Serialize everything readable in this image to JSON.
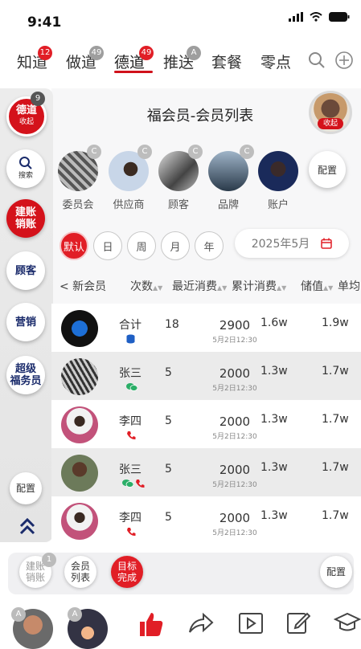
{
  "status": {
    "time": "9:41"
  },
  "topnav": {
    "tabs": [
      {
        "label": "知道",
        "badge": "12",
        "badge_color": "red"
      },
      {
        "label": "做道",
        "badge": "49",
        "badge_color": "gray"
      },
      {
        "label": "德道",
        "badge": "49",
        "badge_color": "red",
        "active": true
      },
      {
        "label": "推送",
        "badge": "A",
        "badge_color": "gray"
      },
      {
        "label": "套餐"
      },
      {
        "label": "零点"
      }
    ]
  },
  "sidebar": {
    "top": {
      "label": "德道",
      "sub": "收起",
      "badge": "9"
    },
    "search": {
      "label": "搜索"
    },
    "account": {
      "label": "建账\n销账"
    },
    "customer": {
      "label": "顾客"
    },
    "marketing": {
      "label": "营销"
    },
    "super": {
      "label": "超级\n福务员"
    },
    "config": {
      "label": "配置"
    }
  },
  "header": {
    "title": "福会员-会员列表",
    "avatar_sub": "收起"
  },
  "categories": [
    {
      "label": "委员会",
      "badge": "C"
    },
    {
      "label": "供应商",
      "badge": "C"
    },
    {
      "label": "顾客",
      "badge": "C"
    },
    {
      "label": "品牌",
      "badge": "C"
    },
    {
      "label": "账户"
    }
  ],
  "category_config": "配置",
  "filters": {
    "periods": [
      "默认",
      "日",
      "周",
      "月",
      "年"
    ],
    "selected": "默认",
    "date": "2025年5月"
  },
  "table": {
    "columns": [
      "< 新会员",
      "次数",
      "最近消费",
      "累计消费",
      "储值",
      "单均"
    ],
    "rows": [
      {
        "name": "合计",
        "count": "18",
        "recent": "2900",
        "recent_time": "5月2日12:30",
        "total": "1.6w",
        "stored": "1.9w",
        "channel": "db"
      },
      {
        "name": "张三",
        "count": "5",
        "recent": "2000",
        "recent_time": "5月2日12:30",
        "total": "1.3w",
        "stored": "1.7w",
        "channel": "wechat"
      },
      {
        "name": "李四",
        "count": "5",
        "recent": "2000",
        "recent_time": "5月2日12:30",
        "total": "1.3w",
        "stored": "1.7w",
        "channel": "phone"
      },
      {
        "name": "张三",
        "count": "5",
        "recent": "2000",
        "recent_time": "5月2日12:30",
        "total": "1.3w",
        "stored": "1.7w",
        "channel": "wechat+phone"
      },
      {
        "name": "李四",
        "count": "5",
        "recent": "2000",
        "recent_time": "5月2日12:30",
        "total": "1.3w",
        "stored": "1.7w",
        "channel": "phone"
      }
    ]
  },
  "bottom_bar": {
    "account": {
      "label": "建账\n销账",
      "badge": "1"
    },
    "member_list": {
      "label": "会员\n列表"
    },
    "target": {
      "label": "目标\n完成"
    },
    "config": "配置"
  },
  "dock": {
    "badges": [
      "A",
      "A"
    ]
  },
  "colors": {
    "accent": "#e11e26",
    "navy": "#1a2b6b"
  }
}
